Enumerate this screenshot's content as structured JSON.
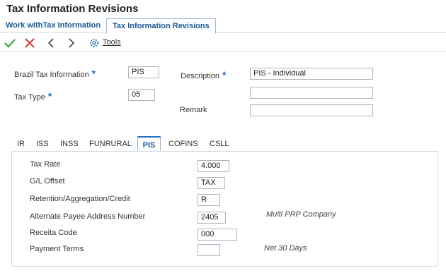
{
  "page_title": "Tax Information Revisions",
  "app_tabs": [
    {
      "label": "Work withTax Information"
    },
    {
      "label": "Tax Information Revisions"
    }
  ],
  "toolbar": {
    "tools_label": "Tools",
    "icons": [
      "checkmark-icon",
      "close-icon",
      "chevron-left-icon",
      "chevron-right-icon",
      "gear-icon"
    ]
  },
  "header_form": {
    "brazil_tax_info": {
      "label": "Brazil Tax Information",
      "value": "PIS"
    },
    "tax_type": {
      "label": "Tax Type",
      "value": "05"
    },
    "description": {
      "label": "Description",
      "value": "PIS - Individual"
    },
    "description2": {
      "value": ""
    },
    "remark": {
      "label": "Remark",
      "value": ""
    }
  },
  "detail_tabs": [
    {
      "label": "IR",
      "active": false
    },
    {
      "label": "ISS",
      "active": false
    },
    {
      "label": "INSS",
      "active": false
    },
    {
      "label": "FUNRURAL",
      "active": false
    },
    {
      "label": "PIS",
      "active": true
    },
    {
      "label": "COFINS",
      "active": false
    },
    {
      "label": "CSLL",
      "active": false
    }
  ],
  "pis_panel": {
    "tax_rate": {
      "label": "Tax Rate",
      "value": "4.000"
    },
    "gl_offset": {
      "label": "G/L Offset",
      "value": "TAX"
    },
    "retention": {
      "label": "Retention/Aggregation/Credit",
      "value": "R"
    },
    "alt_payee": {
      "label": "Alternate Payee Address Number",
      "value": "2405",
      "description": "Multi PRP Company"
    },
    "receita": {
      "label": "Receita Code",
      "value": "000"
    },
    "payment_terms": {
      "label": "Payment Terms",
      "value": "",
      "description": "Net 30 Days"
    }
  },
  "colors": {
    "link_blue": "#1a5a96",
    "required_star": "#2a6fbf",
    "ok_green": "#2e9e3a",
    "cancel_red": "#d23a3a"
  }
}
